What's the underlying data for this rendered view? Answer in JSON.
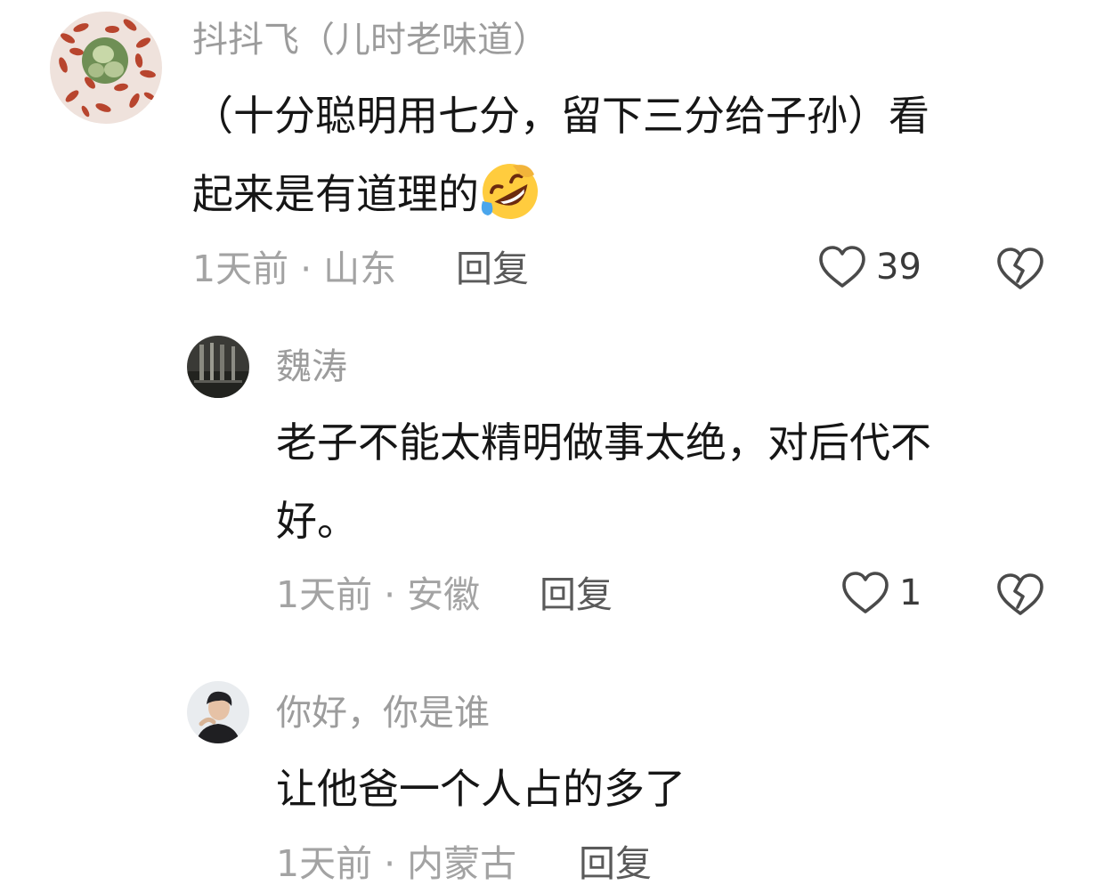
{
  "comments": [
    {
      "username": "抖抖飞（儿时老味道）",
      "text_line1": "（十分聪明用七分，留下三分给子孙）看",
      "text_line2": "起来是有道理的",
      "emoji": "rolling-on-floor-laughing-emoji",
      "time": "1天前",
      "location": "山东",
      "meta": "1天前 · 山东",
      "reply_label": "回复",
      "likes": "39"
    },
    {
      "username": "魏涛",
      "text_line1": "老子不能太精明做事太绝，对后代不",
      "text_line2": "好。",
      "time": "1天前",
      "location": "安徽",
      "meta": "1天前 · 安徽",
      "reply_label": "回复",
      "likes": "1"
    },
    {
      "username": "你好，你是谁",
      "text_line1": "让他爸一个人占的多了",
      "time": "1天前",
      "location": "内蒙古",
      "meta": "1天前 · 内蒙古",
      "reply_label": "回复"
    }
  ],
  "colors": {
    "text": "#161616",
    "muted": "#9c9c9c",
    "reply": "#5a5a5a",
    "icon": "#4a4a4a"
  }
}
